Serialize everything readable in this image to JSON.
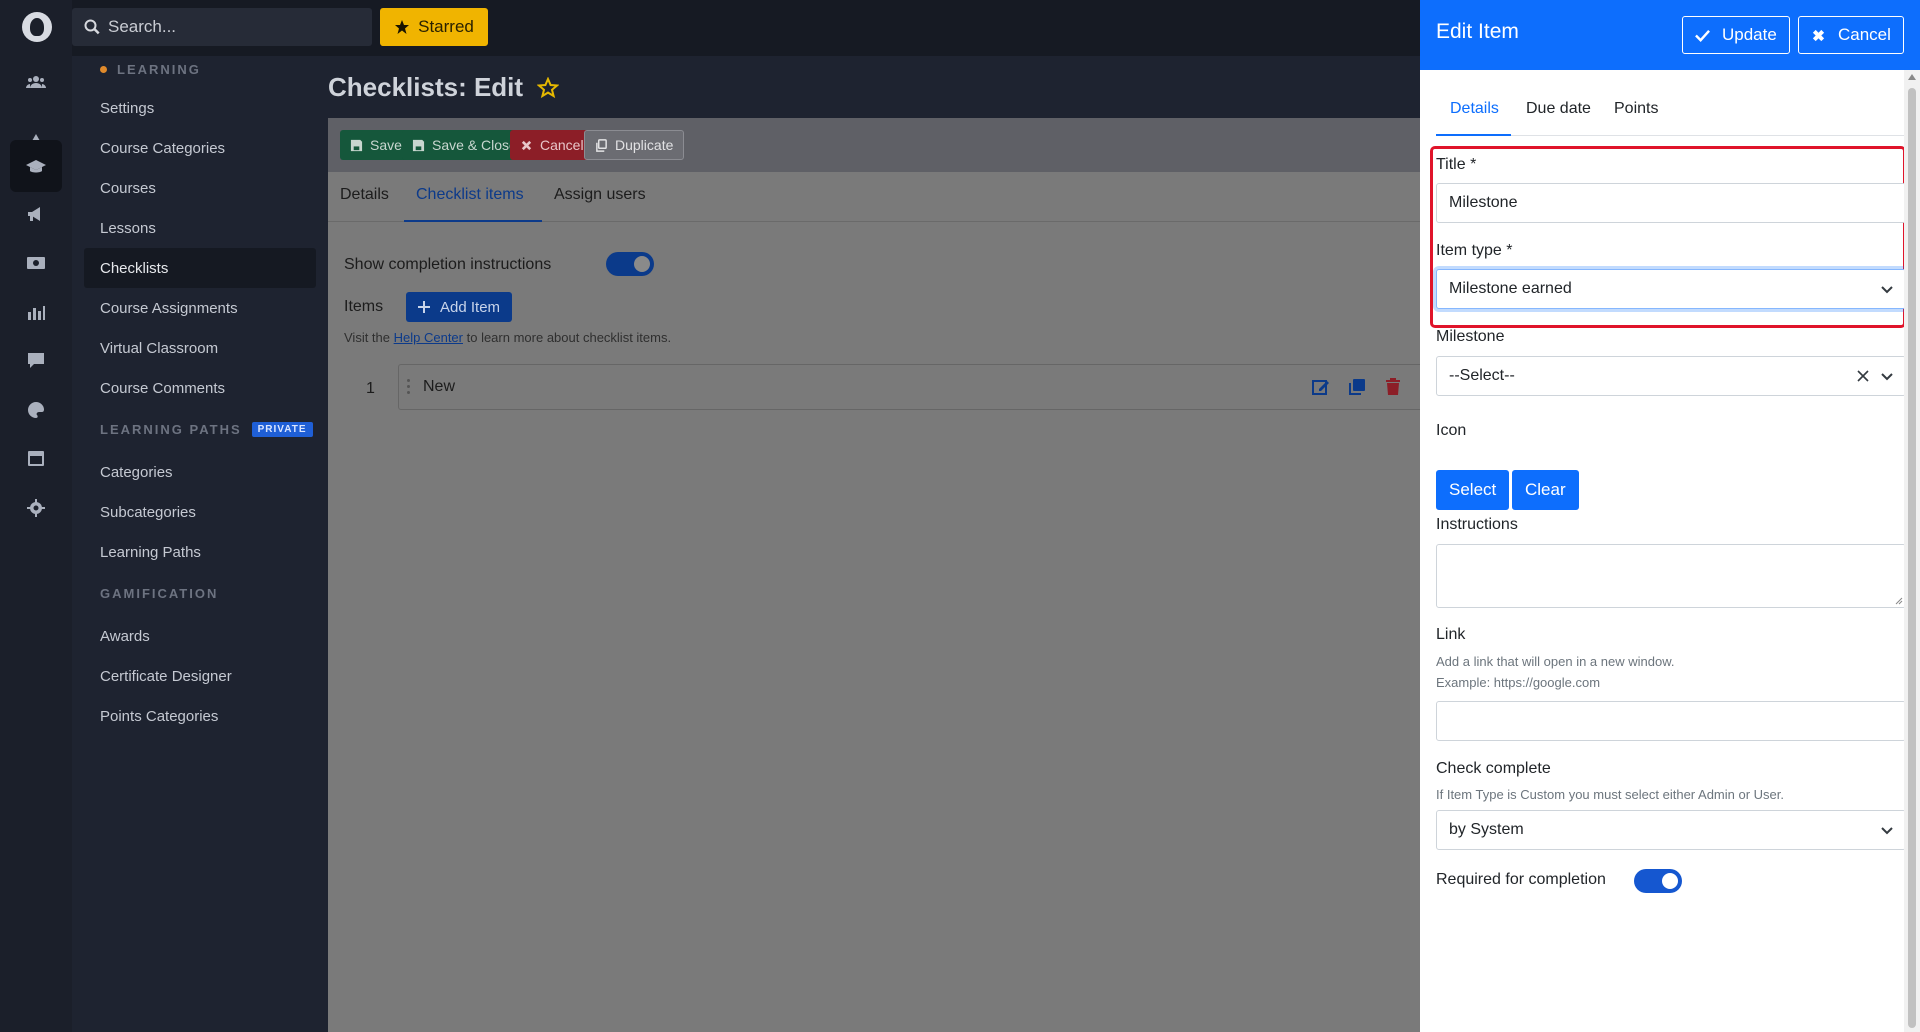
{
  "topbar": {
    "search_placeholder": "Search...",
    "starred_label": "Starred"
  },
  "sidebar": {
    "section_learning": "LEARNING",
    "learning_items": [
      "Settings",
      "Course Categories",
      "Courses",
      "Lessons",
      "Checklists",
      "Course Assignments",
      "Virtual Classroom",
      "Course Comments"
    ],
    "section_paths": "LEARNING PATHS",
    "paths_badge": "PRIVATE",
    "paths_items": [
      "Categories",
      "Subcategories",
      "Learning Paths"
    ],
    "section_gamification": "GAMIFICATION",
    "gamification_items": [
      "Awards",
      "Certificate Designer",
      "Points Categories"
    ],
    "active_item": "Checklists"
  },
  "main": {
    "page_title": "Checklists: Edit",
    "toolbar": {
      "save": "Save",
      "save_close": "Save & Close",
      "cancel": "Cancel",
      "duplicate": "Duplicate"
    },
    "tabs": [
      "Details",
      "Checklist items",
      "Assign users"
    ],
    "active_tab": "Checklist items",
    "show_instructions_label": "Show completion instructions",
    "items_label": "Items",
    "add_item_label": "Add Item",
    "help_prefix": "Visit the ",
    "help_link": "Help Center",
    "help_suffix": " to learn more about checklist items.",
    "item_rows": [
      {
        "index": "1",
        "title": "New"
      }
    ]
  },
  "panel": {
    "title": "Edit Item",
    "update_label": "Update",
    "cancel_label": "Cancel",
    "tabs": [
      "Details",
      "Due date",
      "Points"
    ],
    "active_tab": "Details",
    "title_label": "Title *",
    "title_value": "Milestone",
    "item_type_label": "Item type *",
    "item_type_value": "Milestone earned",
    "milestone_label": "Milestone",
    "milestone_value": "--Select--",
    "icon_label": "Icon",
    "icon_select": "Select",
    "icon_clear": "Clear",
    "instructions_label": "Instructions",
    "link_label": "Link",
    "link_hint1": "Add a link that will open in a new window.",
    "link_hint2": "Example: https://google.com",
    "check_complete_label": "Check complete",
    "check_complete_hint": "If Item Type is Custom you must select either Admin or User.",
    "check_complete_value": "by System",
    "required_label": "Required for completion"
  },
  "colors": {
    "primary": "#0d6efd",
    "highlight_border": "#e0142a",
    "starred": "#f0b400",
    "save_green": "#198754",
    "cancel_red": "#dc3545"
  }
}
